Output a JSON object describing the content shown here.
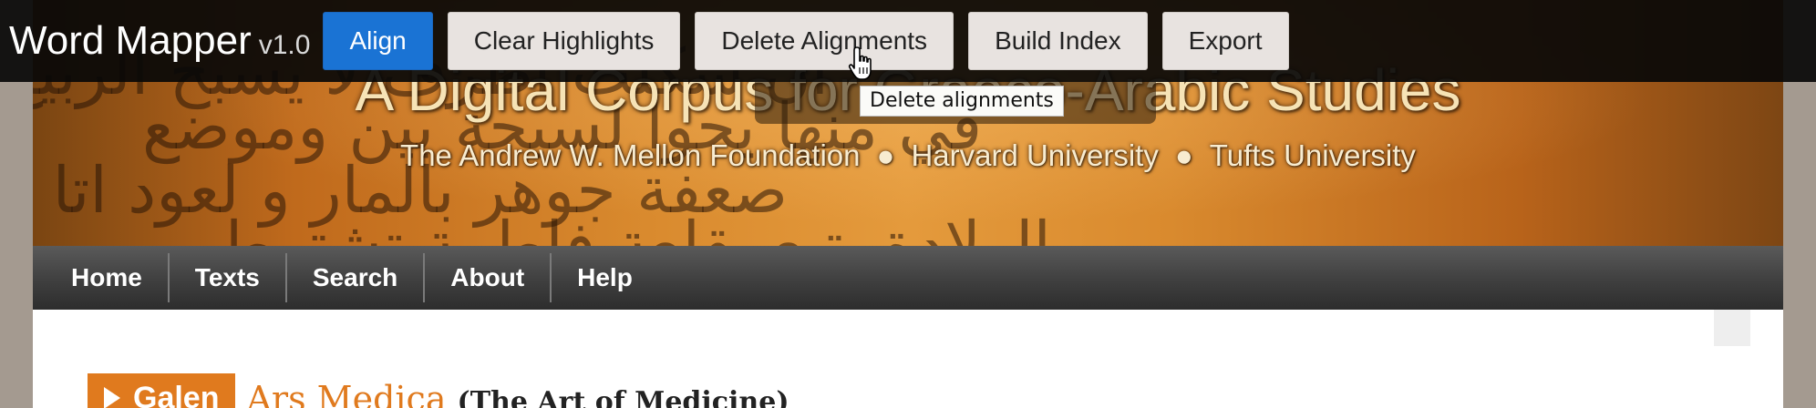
{
  "toolbar": {
    "app_name": "Word Mapper",
    "version": "v1.0",
    "buttons": {
      "align": "Align",
      "clear_highlights": "Clear Highlights",
      "delete_alignments": "Delete Alignments",
      "build_index": "Build Index",
      "export": "Export"
    },
    "tooltip": "Delete alignments",
    "colors": {
      "primary": "#1a73d4",
      "bar": "#080808"
    }
  },
  "banner": {
    "title": "A Digital Corpus for Graeco-Arabic Studies",
    "subtitle_parts": [
      "The Andrew W. Mellon Foundation",
      "Harvard University",
      "Tufts University"
    ],
    "separator": "●",
    "background_script_rows": [
      "ان شكلت اطرف لا يسبح الربيع",
      "قي منها يحوا لسبحة بين وموضع",
      "صعفة جوهر بالمار و لعود اتا الا",
      "الولادة يتبع بقلعة فاطمة تشترط"
    ]
  },
  "nav": {
    "items": [
      "Home",
      "Texts",
      "Search",
      "About",
      "Help"
    ]
  },
  "content": {
    "author": "Galen",
    "work_title": "Ars Medica",
    "work_subtitle": "(The Art of Medicine)",
    "accent_color": "#e07a1e"
  }
}
